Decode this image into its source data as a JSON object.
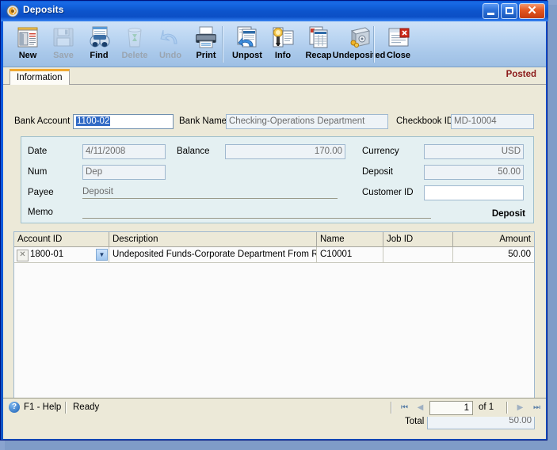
{
  "window": {
    "title": "Deposits",
    "icon": "app-icon",
    "buttons": {
      "minimize": "Minimize",
      "maximize": "Maximize",
      "close": "Close"
    }
  },
  "toolbar": {
    "items": [
      {
        "label": "New",
        "icon": "new-document-icon",
        "enabled": true
      },
      {
        "label": "Save",
        "icon": "floppy-disk-icon",
        "enabled": false
      },
      {
        "label": "Find",
        "icon": "binoculars-icon",
        "enabled": true
      },
      {
        "label": "Delete",
        "icon": "recycle-bin-icon",
        "enabled": false
      },
      {
        "label": "Undo",
        "icon": "undo-arrow-icon",
        "enabled": false
      },
      {
        "label": "Print",
        "icon": "printer-icon",
        "enabled": true
      },
      {
        "label": "Unpost",
        "icon": "unpost-icon",
        "enabled": true
      },
      {
        "label": "Info",
        "icon": "info-lamp-icon",
        "enabled": true
      },
      {
        "label": "Recap",
        "icon": "recap-report-icon",
        "enabled": true
      },
      {
        "label": "Undeposited",
        "icon": "safe-vault-icon",
        "enabled": true
      },
      {
        "label": "Close",
        "icon": "close-window-icon",
        "enabled": true
      }
    ]
  },
  "tabs": {
    "active": "Information",
    "status_label": "Posted"
  },
  "form": {
    "bank_account": {
      "label": "Bank Account",
      "value": "1100-02",
      "selected": true
    },
    "bank_name": {
      "label": "Bank Name",
      "value": "Checking-Operations Department"
    },
    "checkbook_id": {
      "label": "Checkbook ID",
      "value": "MD-10004"
    },
    "date": {
      "label": "Date",
      "value": "4/11/2008"
    },
    "balance": {
      "label": "Balance",
      "value": "170.00"
    },
    "currency": {
      "label": "Currency",
      "value": "USD"
    },
    "num": {
      "label": "Num",
      "value": "Dep"
    },
    "deposit": {
      "label": "Deposit",
      "value": "50.00"
    },
    "payee": {
      "label": "Payee",
      "value": "Deposit"
    },
    "customer_id": {
      "label": "Customer ID",
      "value": ""
    },
    "memo": {
      "label": "Memo",
      "value": ""
    },
    "type_label": "Deposit"
  },
  "grid": {
    "columns": [
      "Account ID",
      "Description",
      "Name",
      "Job ID",
      "Amount"
    ],
    "rows": [
      {
        "remove": "✕",
        "account_id": "1800-01",
        "description": "Undeposited Funds-Corporate Department From R",
        "name": "C10001",
        "job_id": "",
        "amount": "50.00"
      }
    ]
  },
  "total": {
    "label": "Total",
    "value": "50.00"
  },
  "statusbar": {
    "help": "F1 - Help",
    "state": "Ready",
    "nav": {
      "first": "⏮",
      "prev": "◀",
      "page": "1",
      "of": "of  1",
      "next": "▶",
      "last": "⏭"
    }
  },
  "colors": {
    "titlebar": "#0d54cc",
    "posted": "#8b1a1a",
    "selection": "#316ac5",
    "groupbox": "#e4f0f2",
    "client": "#ece9d8"
  }
}
